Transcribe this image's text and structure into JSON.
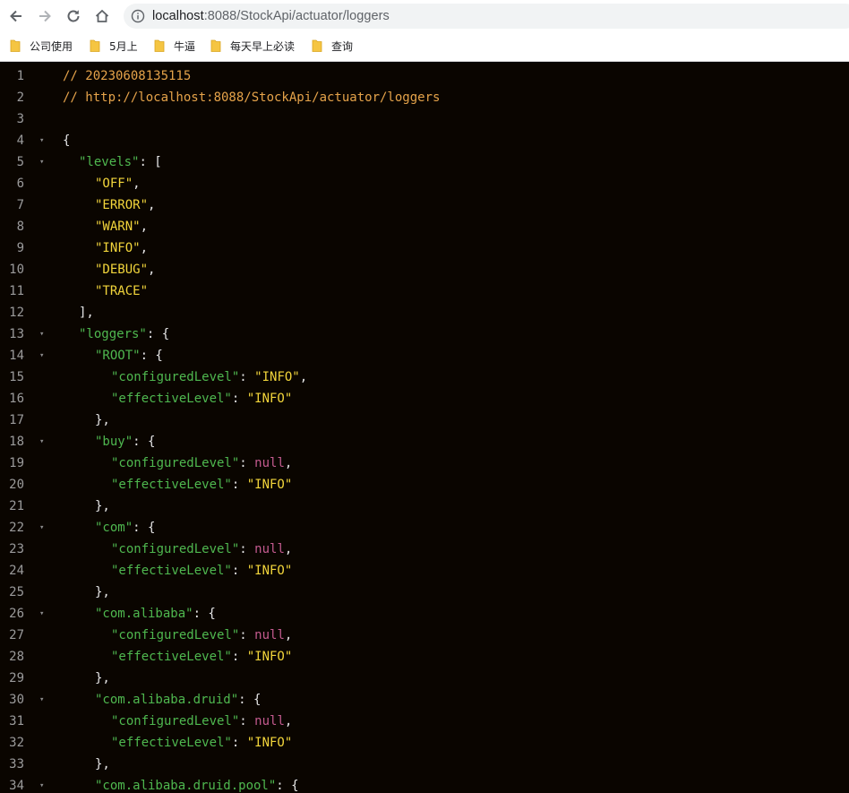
{
  "browser": {
    "url_host": "localhost",
    "url_path": ":8088/StockApi/actuator/loggers",
    "bookmarks": [
      {
        "label": "公司使用"
      },
      {
        "label": "5月上"
      },
      {
        "label": "牛逼"
      },
      {
        "label": "每天早上必读"
      },
      {
        "label": "查询"
      }
    ]
  },
  "colors": {
    "background": "#0a0500",
    "comment": "#e5a34a",
    "key": "#4fb84f",
    "string": "#f2d53b",
    "null": "#c45b8e",
    "line_number": "#9b9b9b"
  },
  "json_view": {
    "lines": [
      {
        "num": "1",
        "fold": "",
        "tokens": [
          {
            "t": "cm",
            "v": "// 20230608135115"
          }
        ]
      },
      {
        "num": "2",
        "fold": "",
        "tokens": [
          {
            "t": "cm",
            "v": "// http://localhost:8088/StockApi/actuator/loggers"
          }
        ]
      },
      {
        "num": "3",
        "fold": "",
        "tokens": []
      },
      {
        "num": "4",
        "fold": "▾",
        "tokens": [
          {
            "t": "p",
            "v": "{"
          }
        ]
      },
      {
        "num": "5",
        "fold": "▾",
        "tokens": [
          {
            "t": "k",
            "v": "\"levels\""
          },
          {
            "t": "p",
            "v": ": ["
          }
        ]
      },
      {
        "num": "6",
        "fold": "",
        "tokens": [
          {
            "t": "s",
            "v": "\"OFF\""
          },
          {
            "t": "p",
            "v": ","
          }
        ]
      },
      {
        "num": "7",
        "fold": "",
        "tokens": [
          {
            "t": "s",
            "v": "\"ERROR\""
          },
          {
            "t": "p",
            "v": ","
          }
        ]
      },
      {
        "num": "8",
        "fold": "",
        "tokens": [
          {
            "t": "s",
            "v": "\"WARN\""
          },
          {
            "t": "p",
            "v": ","
          }
        ]
      },
      {
        "num": "9",
        "fold": "",
        "tokens": [
          {
            "t": "s",
            "v": "\"INFO\""
          },
          {
            "t": "p",
            "v": ","
          }
        ]
      },
      {
        "num": "10",
        "fold": "",
        "tokens": [
          {
            "t": "s",
            "v": "\"DEBUG\""
          },
          {
            "t": "p",
            "v": ","
          }
        ]
      },
      {
        "num": "11",
        "fold": "",
        "tokens": [
          {
            "t": "s",
            "v": "\"TRACE\""
          }
        ]
      },
      {
        "num": "12",
        "fold": "",
        "tokens": [
          {
            "t": "p",
            "v": "],"
          }
        ]
      },
      {
        "num": "13",
        "fold": "▾",
        "tokens": [
          {
            "t": "k",
            "v": "\"loggers\""
          },
          {
            "t": "p",
            "v": ": {"
          }
        ]
      },
      {
        "num": "14",
        "fold": "▾",
        "tokens": [
          {
            "t": "k",
            "v": "\"ROOT\""
          },
          {
            "t": "p",
            "v": ": {"
          }
        ]
      },
      {
        "num": "15",
        "fold": "",
        "tokens": [
          {
            "t": "k",
            "v": "\"configuredLevel\""
          },
          {
            "t": "p",
            "v": ": "
          },
          {
            "t": "s",
            "v": "\"INFO\""
          },
          {
            "t": "p",
            "v": ","
          }
        ]
      },
      {
        "num": "16",
        "fold": "",
        "tokens": [
          {
            "t": "k",
            "v": "\"effectiveLevel\""
          },
          {
            "t": "p",
            "v": ": "
          },
          {
            "t": "s",
            "v": "\"INFO\""
          }
        ]
      },
      {
        "num": "17",
        "fold": "",
        "tokens": [
          {
            "t": "p",
            "v": "},"
          }
        ]
      },
      {
        "num": "18",
        "fold": "▾",
        "tokens": [
          {
            "t": "k",
            "v": "\"buy\""
          },
          {
            "t": "p",
            "v": ": {"
          }
        ]
      },
      {
        "num": "19",
        "fold": "",
        "tokens": [
          {
            "t": "k",
            "v": "\"configuredLevel\""
          },
          {
            "t": "p",
            "v": ": "
          },
          {
            "t": "n",
            "v": "null"
          },
          {
            "t": "p",
            "v": ","
          }
        ]
      },
      {
        "num": "20",
        "fold": "",
        "tokens": [
          {
            "t": "k",
            "v": "\"effectiveLevel\""
          },
          {
            "t": "p",
            "v": ": "
          },
          {
            "t": "s",
            "v": "\"INFO\""
          }
        ]
      },
      {
        "num": "21",
        "fold": "",
        "tokens": [
          {
            "t": "p",
            "v": "},"
          }
        ]
      },
      {
        "num": "22",
        "fold": "▾",
        "tokens": [
          {
            "t": "k",
            "v": "\"com\""
          },
          {
            "t": "p",
            "v": ": {"
          }
        ]
      },
      {
        "num": "23",
        "fold": "",
        "tokens": [
          {
            "t": "k",
            "v": "\"configuredLevel\""
          },
          {
            "t": "p",
            "v": ": "
          },
          {
            "t": "n",
            "v": "null"
          },
          {
            "t": "p",
            "v": ","
          }
        ]
      },
      {
        "num": "24",
        "fold": "",
        "tokens": [
          {
            "t": "k",
            "v": "\"effectiveLevel\""
          },
          {
            "t": "p",
            "v": ": "
          },
          {
            "t": "s",
            "v": "\"INFO\""
          }
        ]
      },
      {
        "num": "25",
        "fold": "",
        "tokens": [
          {
            "t": "p",
            "v": "},"
          }
        ]
      },
      {
        "num": "26",
        "fold": "▾",
        "tokens": [
          {
            "t": "k",
            "v": "\"com.alibaba\""
          },
          {
            "t": "p",
            "v": ": {"
          }
        ]
      },
      {
        "num": "27",
        "fold": "",
        "tokens": [
          {
            "t": "k",
            "v": "\"configuredLevel\""
          },
          {
            "t": "p",
            "v": ": "
          },
          {
            "t": "n",
            "v": "null"
          },
          {
            "t": "p",
            "v": ","
          }
        ]
      },
      {
        "num": "28",
        "fold": "",
        "tokens": [
          {
            "t": "k",
            "v": "\"effectiveLevel\""
          },
          {
            "t": "p",
            "v": ": "
          },
          {
            "t": "s",
            "v": "\"INFO\""
          }
        ]
      },
      {
        "num": "29",
        "fold": "",
        "tokens": [
          {
            "t": "p",
            "v": "},"
          }
        ]
      },
      {
        "num": "30",
        "fold": "▾",
        "tokens": [
          {
            "t": "k",
            "v": "\"com.alibaba.druid\""
          },
          {
            "t": "p",
            "v": ": {"
          }
        ]
      },
      {
        "num": "31",
        "fold": "",
        "tokens": [
          {
            "t": "k",
            "v": "\"configuredLevel\""
          },
          {
            "t": "p",
            "v": ": "
          },
          {
            "t": "n",
            "v": "null"
          },
          {
            "t": "p",
            "v": ","
          }
        ]
      },
      {
        "num": "32",
        "fold": "",
        "tokens": [
          {
            "t": "k",
            "v": "\"effectiveLevel\""
          },
          {
            "t": "p",
            "v": ": "
          },
          {
            "t": "s",
            "v": "\"INFO\""
          }
        ]
      },
      {
        "num": "33",
        "fold": "",
        "tokens": [
          {
            "t": "p",
            "v": "},"
          }
        ]
      },
      {
        "num": "34",
        "fold": "▾",
        "tokens": [
          {
            "t": "k",
            "v": "\"com.alibaba.druid.pool\""
          },
          {
            "t": "p",
            "v": ": {"
          }
        ]
      }
    ]
  }
}
